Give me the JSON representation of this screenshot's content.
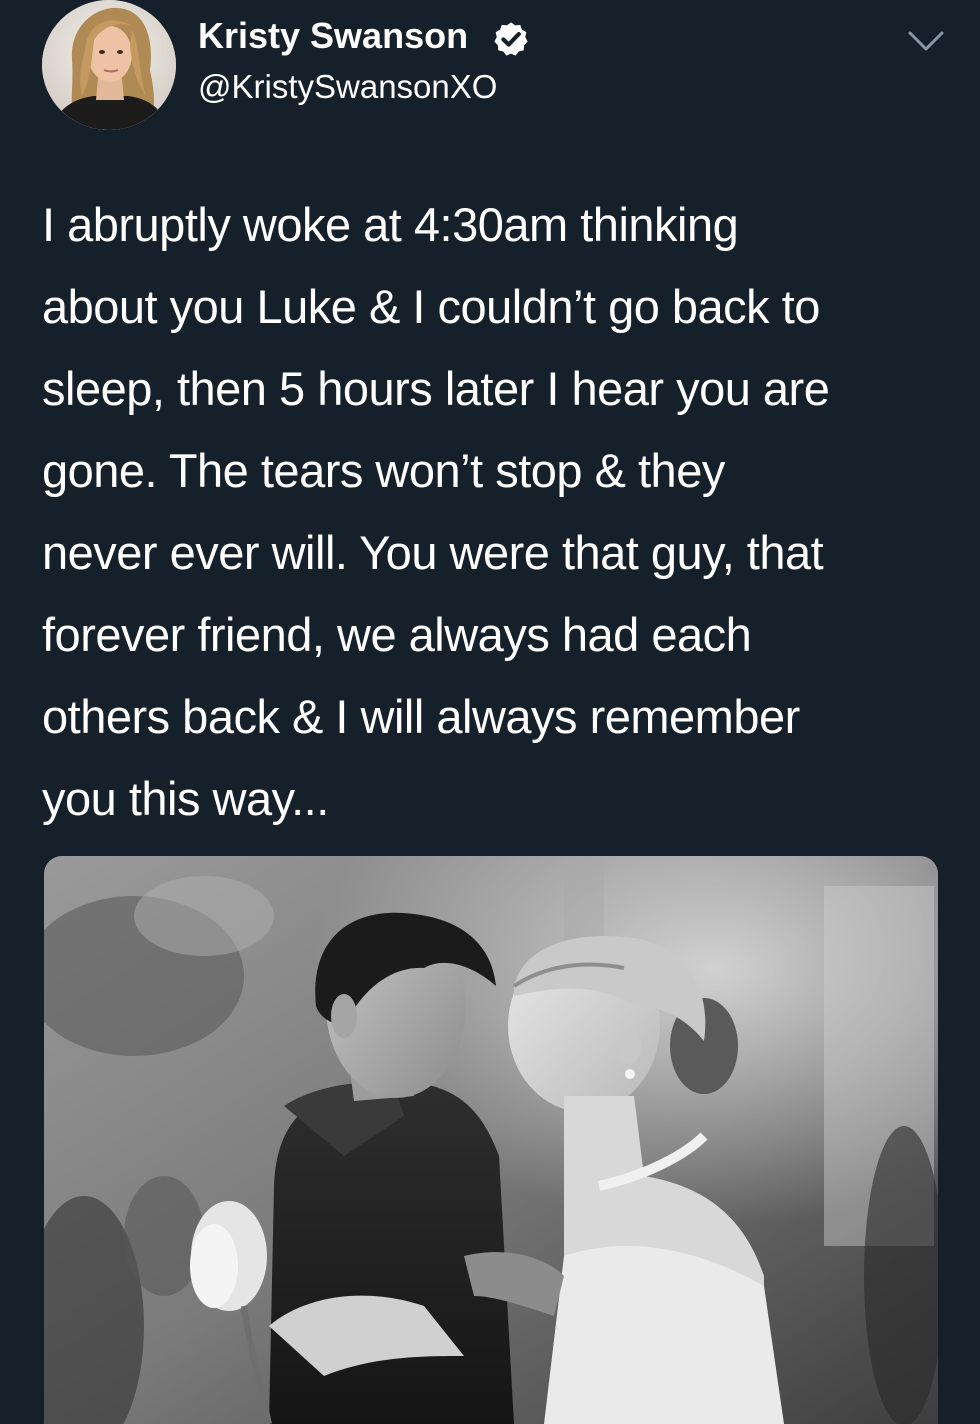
{
  "author": {
    "display_name": "Kristy Swanson",
    "handle": "@KristySwansonXO",
    "verified": true
  },
  "tweet": {
    "text_lines": [
      "I abruptly woke at 4:30am thinking",
      "about you Luke & I couldn’t go back to",
      "sleep, then 5 hours later I hear you are",
      "gone. The tears won’t stop & they",
      "never ever will. You were that guy, that",
      "forever friend, we always had each",
      "others back & I will always remember",
      "you this way..."
    ]
  },
  "media": {
    "kind": "photo",
    "style": "black-and-white"
  },
  "icons": {
    "verified": "verified-badge-icon",
    "menu": "chevron-down-icon"
  },
  "colors": {
    "background": "#15202b",
    "text": "#ffffff",
    "caret": "#8899a6"
  }
}
